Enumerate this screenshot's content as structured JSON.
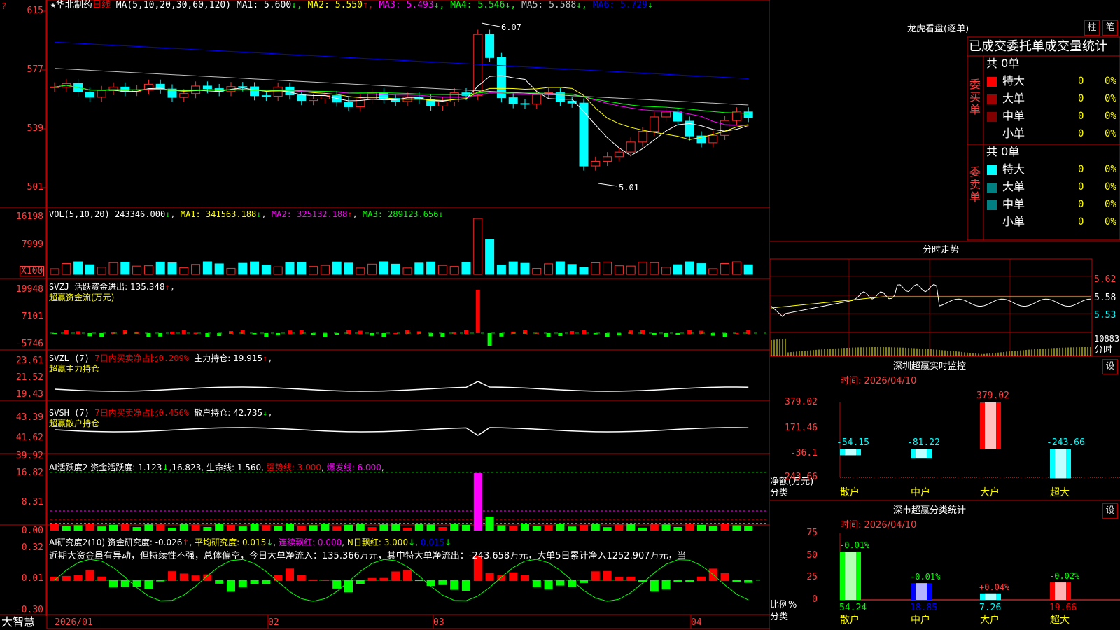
{
  "main": {
    "stock_name": "华北制药",
    "period": "日线",
    "ma_title": "MA(5,10,20,30,60,120)",
    "ma": [
      {
        "label": "MA1:",
        "value": "5.600",
        "arrow": "↓",
        "color": "#ffffff"
      },
      {
        "label": "MA2:",
        "value": "5.550",
        "arrow": "↑",
        "color": "#ffff00"
      },
      {
        "label": "MA3:",
        "value": "5.493",
        "arrow": "↓",
        "color": "#ff00ff"
      },
      {
        "label": "MA4:",
        "value": "5.546",
        "arrow": "↓",
        "color": "#00ff00"
      },
      {
        "label": "MA5:",
        "value": "5.588",
        "arrow": "↓",
        "color": "#c0c0c0"
      },
      {
        "label": "MA6:",
        "value": "5.729",
        "arrow": "↓",
        "color": "#0000ff"
      }
    ],
    "axis": [
      "615",
      "577",
      "539",
      "501"
    ],
    "hi_label": "6.07",
    "lo_label": "5.01",
    "corner": "?"
  },
  "vol": {
    "title": "VOL(5,10,20)",
    "value": "243346.000",
    "ma1": "341563.188",
    "ma2": "325132.188",
    "ma3": "289123.656",
    "axis": [
      "16198",
      "7999"
    ],
    "unit": "X100"
  },
  "svzj": {
    "title": "SVZJ",
    "text": "活跃资金进出: 135.348",
    "sub": "超赢资金流(万元)",
    "axis": [
      "19948",
      "7101",
      "-5746"
    ]
  },
  "svzl": {
    "title": "SVZL (7)",
    "red": "7日内买卖净占比",
    "red_val": "0.209%",
    "text": "主力持仓: 19.915",
    "sub": "超赢主力持仓",
    "axis": [
      "23.61",
      "21.52",
      "19.43"
    ]
  },
  "svsh": {
    "title": "SVSH (7)",
    "red": "7日内买卖净占比",
    "red_val": "0.456%",
    "text": "散户持仓: 42.735",
    "sub": "超赢散户持仓",
    "axis": [
      "43.39",
      "41.62",
      "39.92"
    ]
  },
  "ai1": {
    "title": "AI活跃度2",
    "text": "资金活跃度: 1.123",
    "v2": "16.823",
    "life": "生命线: 1.560",
    "strong": "强势线: 3.000",
    "burst": "爆发线: 6.000",
    "axis": [
      "16.82",
      "8.31",
      "0.00"
    ]
  },
  "ai2": {
    "title": "AI研究度2(10)",
    "t1": "资金研究度: -0.026",
    "t2": "平均研究度: 0.015",
    "t3": "连续飘红: 0.000",
    "t4": "N日飘红: 3.000",
    "t5": "0.015",
    "comment": "近期大资金虽有异动，但持续性不强，总体偏空，今日大单净流入：135.366万元，其中特大单净流出：-243.658万元，大单5日累计净入1252.907万元，当",
    "axis": [
      "0.32",
      "0.01",
      "-0.30"
    ]
  },
  "xaxis": {
    "brand": "大智慧",
    "labels": [
      "2026/01",
      "02",
      "03",
      "04"
    ]
  },
  "longhu": {
    "title": "龙虎看盘(逐单)",
    "btn1": "柱",
    "btn2": "笔",
    "header": "已成交委托单成交量统计",
    "buy_label": "委买单",
    "sell_label": "委卖单",
    "buy_total": "共 0单",
    "sell_total": "共 0单",
    "rows": [
      "特大",
      "大单",
      "中单",
      "小单"
    ],
    "buy_colors": [
      "#ff0000",
      "#a00000",
      "#800000",
      ""
    ],
    "sell_colors": [
      "#00ffff",
      "#008080",
      "#008080",
      ""
    ],
    "zero": "0",
    "pct": "0%"
  },
  "minute": {
    "title": "分时走势",
    "axis": [
      "5.62",
      "5.58",
      "5.53"
    ],
    "vol_label": "10883",
    "sub": "分时"
  },
  "monitor": {
    "title": "深圳超赢实时监控",
    "btn": "设",
    "time": "时间: 2026/04/10",
    "axis": [
      "379.02",
      "171.46",
      "-36.1",
      "-243.66"
    ],
    "ylabel1": "净额(万元)",
    "ylabel2": "分类",
    "categories": [
      "散户",
      "中户",
      "大户",
      "超大"
    ],
    "values": [
      "-54.15",
      "-81.22",
      "379.02",
      "-243.66"
    ]
  },
  "stats": {
    "title": "深市超赢分类统计",
    "btn": "设",
    "time": "时间: 2026/04/10",
    "axis": [
      "75",
      "50",
      "25",
      "0"
    ],
    "ylabel1": "比例%",
    "ylabel2": "分类",
    "categories": [
      "散户",
      "中户",
      "大户",
      "超大"
    ],
    "pcts": [
      "54.24",
      "18.85",
      "7.26",
      "19.66"
    ],
    "changes": [
      "-0.01%",
      "-0.01%",
      "+0.04%",
      "-0.02%"
    ]
  },
  "chart_data": [
    {
      "type": "bar",
      "title": "深圳超赢实时监控",
      "ylabel": "净额(万元)",
      "categories": [
        "散户",
        "中户",
        "大户",
        "超大"
      ],
      "values": [
        -54.15,
        -81.22,
        379.02,
        -243.66
      ],
      "ylim": [
        -243.66,
        379.02
      ]
    },
    {
      "type": "bar",
      "title": "深市超赢分类统计",
      "ylabel": "比例%",
      "categories": [
        "散户",
        "中户",
        "大户",
        "超大"
      ],
      "values": [
        54.24,
        18.85,
        7.26,
        19.66
      ],
      "ylim": [
        0,
        75
      ]
    }
  ]
}
